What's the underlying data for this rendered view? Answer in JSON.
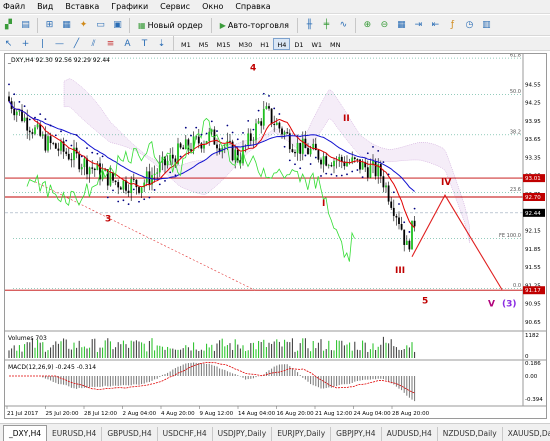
{
  "menu": [
    "Файл",
    "Вид",
    "Вставка",
    "Графики",
    "Сервис",
    "Окно",
    "Справка"
  ],
  "toolbar": {
    "new_order": "Новый ордер",
    "autotrading": "Авто-торговля",
    "timeframes": [
      "M1",
      "M5",
      "M15",
      "M30",
      "H1",
      "H4",
      "D1",
      "W1",
      "MN"
    ],
    "active_timeframe": "H4"
  },
  "chart": {
    "header": "_DXY,H4  92.30 92.56 92.29 92.44",
    "price_scale": [
      "94.55",
      "94.25",
      "93.95",
      "93.65",
      "93.35",
      "93.05",
      "92.75",
      "92.44",
      "92.15",
      "91.85",
      "91.55",
      "91.25",
      "90.95",
      "90.65"
    ],
    "level_tags": [
      {
        "text": "93.01",
        "price": 93.01,
        "color": "#c00000"
      },
      {
        "text": "92.70",
        "price": 92.7,
        "color": "#c00000"
      },
      {
        "text": "92.44",
        "price": 92.44,
        "color": "#000000"
      },
      {
        "text": "91.17",
        "price": 91.17,
        "color": "#c00000"
      }
    ],
    "fib_labels": [
      {
        "text": "61.8",
        "price": 94.98
      },
      {
        "text": "50.0",
        "price": 94.38
      },
      {
        "text": "38.2",
        "price": 93.72
      },
      {
        "text": "23.6",
        "price": 92.77
      },
      {
        "text": "FE 100.0",
        "price": 92.02
      },
      {
        "text": "0.0",
        "price": 91.2
      }
    ],
    "wave_labels": [
      "4",
      "II",
      "3",
      "I",
      "III",
      "IV",
      "5",
      "V",
      "(3)"
    ],
    "volume_header": "Volumes 703",
    "volume_scale": [
      "1182",
      "0"
    ],
    "macd_header": "MACD(12,26,9) -0.245 -0.314",
    "macd_scale": [
      "0.186",
      "0.00",
      "-0.394"
    ],
    "time_axis": [
      "21 Jul 2017",
      "25 Jul 20:00",
      "28 Jul 12:00",
      "2 Aug 04:00",
      "4 Aug 20:00",
      "9 Aug 12:00",
      "14 Aug 04:00",
      "16 Aug 20:00",
      "21 Aug 12:00",
      "24 Aug 04:00",
      "28 Aug 20:00"
    ],
    "colors": {
      "bull": "#1fbf1f",
      "bear": "#000000",
      "tenkan": "#e00000",
      "kijun": "#1010d0",
      "chikou": "#33dd33",
      "kumo": "#c89bd6",
      "psar": "#000080",
      "levels": "#c00000"
    }
  },
  "tabs": [
    "_DXY,H4",
    "EURUSD,H4",
    "GBPUSD,H4",
    "USDCHF,H4",
    "USDJPY,Daily",
    "EURJPY,Daily",
    "GBPJPY,H4",
    "AUDUSD,H4",
    "NZDUSD,Daily",
    "XAUUSD,Daily"
  ],
  "active_tab": "_DXY,H4"
}
